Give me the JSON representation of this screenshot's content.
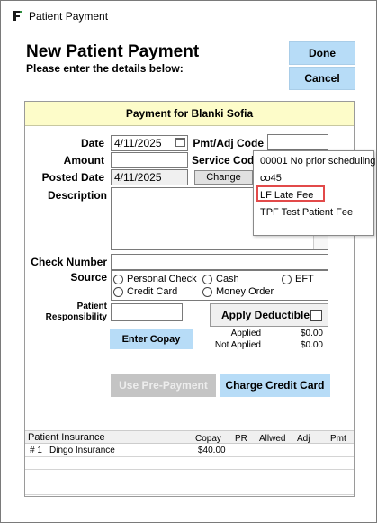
{
  "window": {
    "title": "Patient Payment"
  },
  "header": {
    "title": "New Patient Payment",
    "subtitle": "Please enter the details below:"
  },
  "actions": {
    "done_label": "Done",
    "cancel_label": "Cancel"
  },
  "panel": {
    "title": "Payment for Blanki Sofia"
  },
  "form": {
    "date_label": "Date",
    "date_value": "4/11/2025",
    "amount_label": "Amount",
    "amount_value": "",
    "posted_date_label": "Posted Date",
    "posted_date_value": "4/11/2025",
    "change_label": "Change",
    "pmt_adj_code_label": "Pmt/Adj Code",
    "pmt_adj_code_value": "",
    "service_code_label": "Service Cod",
    "description_label": "Description",
    "description_value": "",
    "check_number_label": "Check Number",
    "check_number_value": "",
    "source_label": "Source",
    "source_options": [
      "Personal Check",
      "Cash",
      "EFT",
      "Credit Card",
      "Money Order"
    ],
    "patient_resp_label_1": "Patient",
    "patient_resp_label_2": "Responsibility",
    "patient_resp_value": "",
    "apply_deductible_label": "Apply Deductible",
    "applied_label": "Applied",
    "applied_value": "$0.00",
    "not_applied_label": "Not Applied",
    "not_applied_value": "$0.00",
    "enter_copay_label": "Enter Copay",
    "use_prepayment_label": "Use Pre-Payment",
    "charge_credit_card_label": "Charge Credit Card"
  },
  "dropdown": {
    "items": [
      "00001 No prior scheduling",
      "co45",
      "LF Late Fee",
      "TPF Test Patient Fee"
    ],
    "highlighted_index": 2
  },
  "insurance": {
    "columns": [
      "Patient Insurance",
      "Copay",
      "PR",
      "Allwed",
      "Adj",
      "Pmt"
    ],
    "rows": [
      {
        "num": "# 1",
        "name": "Dingo Insurance",
        "copay": "$40.00"
      }
    ]
  },
  "colors": {
    "button_blue": "#b7dcf7",
    "panel_header": "#fdfcc9",
    "highlight_border": "#e24a4a"
  }
}
